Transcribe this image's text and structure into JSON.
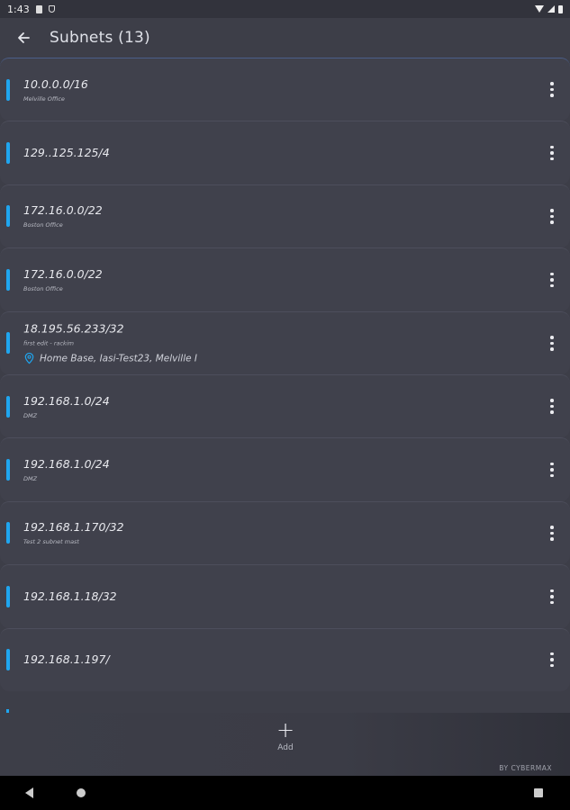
{
  "status_bar": {
    "time": "1:43"
  },
  "app_bar": {
    "title": "Subnets (13)"
  },
  "subnets": [
    {
      "address": "10.0.0.0/16",
      "description": "Melville Office",
      "location": ""
    },
    {
      "address": "129..125.125/4",
      "description": "",
      "location": ""
    },
    {
      "address": "172.16.0.0/22",
      "description": "Boston Office",
      "location": ""
    },
    {
      "address": "172.16.0.0/22",
      "description": "Boston Office",
      "location": ""
    },
    {
      "address": "18.195.56.233/32",
      "description": "first edit - rackim",
      "location": "Home Base, Iasi-Test23, Melville I"
    },
    {
      "address": "192.168.1.0/24",
      "description": "DMZ",
      "location": ""
    },
    {
      "address": "192.168.1.0/24",
      "description": "DMZ",
      "location": ""
    },
    {
      "address": "192.168.1.170/32",
      "description": "Test 2 subnet mast",
      "location": ""
    },
    {
      "address": "192.168.1.18/32",
      "description": "",
      "location": ""
    },
    {
      "address": "192.168.1.197/",
      "description": "",
      "location": ""
    }
  ],
  "bottom_bar": {
    "add_label": "Add",
    "brand": "BY CYBERMAX"
  },
  "colors": {
    "background": "#3d3e48",
    "accent": "#1fa6f0",
    "location_pin": "#1fa6f0"
  },
  "icons": {
    "back": "arrow-left-icon",
    "more": "more-vert-icon",
    "location": "location-pin-icon",
    "add": "plus-icon"
  }
}
